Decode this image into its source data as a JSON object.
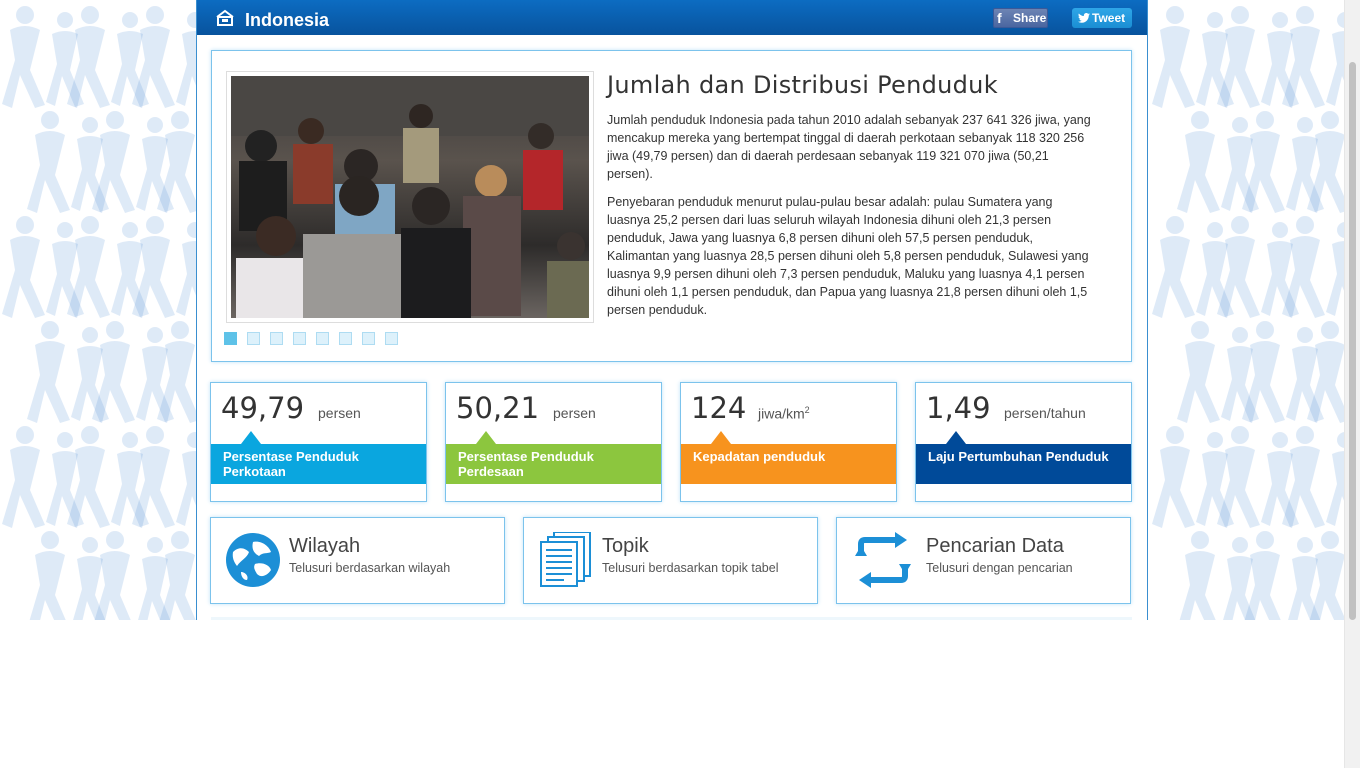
{
  "header": {
    "brand": "Indonesia",
    "share_label": "Share",
    "tweet_label": "Tweet"
  },
  "feature": {
    "title": "Jumlah dan Distribusi Penduduk",
    "paragraph1": "Jumlah penduduk Indonesia pada tahun 2010 adalah sebanyak 237 641 326 jiwa, yang mencakup mereka yang bertempat tinggal di daerah perkotaan sebanyak 118 320 256 jiwa (49,79 persen) dan di daerah perdesaan sebanyak 119 321 070 jiwa (50,21 persen).",
    "paragraph2": "Penyebaran penduduk menurut pulau-pulau besar adalah: pulau Sumatera yang luasnya 25,2 persen dari luas seluruh wilayah Indonesia dihuni oleh 21,3 persen penduduk, Jawa yang luasnya 6,8 persen dihuni oleh 57,5 persen penduduk, Kalimantan yang luasnya 28,5 persen dihuni oleh 5,8 persen penduduk, Sulawesi yang luasnya 9,9 persen dihuni oleh 7,3 persen penduduk, Maluku yang luasnya 4,1 persen dihuni oleh 1,1 persen penduduk, dan Papua yang luasnya 21,8 persen dihuni oleh 1,5 persen penduduk.",
    "slide_count": 8,
    "active_slide": 1
  },
  "stats": [
    {
      "value": "49,79",
      "unit": "persen",
      "label": "Persentase Penduduk Perkotaan",
      "color": "#0aa6df"
    },
    {
      "value": "50,21",
      "unit": "persen",
      "label": "Persentase Penduduk Perdesaan",
      "color": "#8cc63e"
    },
    {
      "value": "124",
      "unit": "jiwa/km",
      "unit_sup": "2",
      "label": "Kepadatan penduduk",
      "color": "#f7931e"
    },
    {
      "value": "1,49",
      "unit": "persen/tahun",
      "label": "Laju Pertumbuhan Penduduk",
      "color": "#004a99"
    }
  ],
  "nav": [
    {
      "title": "Wilayah",
      "subtitle": "Telusuri berdasarkan wilayah",
      "icon": "globe-icon"
    },
    {
      "title": "Topik",
      "subtitle": "Telusuri berdasarkan topik tabel",
      "icon": "documents-icon"
    },
    {
      "title": "Pencarian Data",
      "subtitle": "Telusuri dengan pencarian",
      "icon": "refresh-arrows-icon"
    }
  ]
}
